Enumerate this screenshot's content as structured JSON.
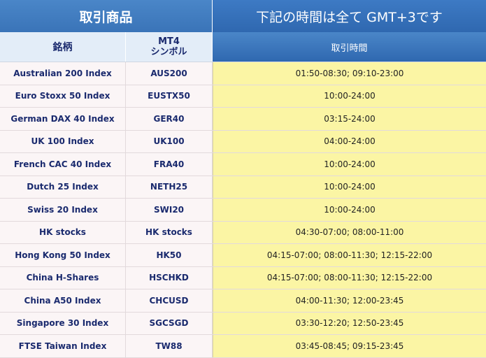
{
  "header": {
    "products_label": "取引商品",
    "note_label": "下記の時間は全て GMT+3です"
  },
  "subheader": {
    "name_label": "銘柄",
    "mt4_line1": "MT4",
    "mt4_line2": "シンボル",
    "hours_label": "取引時間"
  },
  "rows": [
    {
      "name": "Australian 200 Index",
      "symbol": "AUS200",
      "hours": "01:50-08:30; 09:10-23:00"
    },
    {
      "name": "Euro Stoxx 50 Index",
      "symbol": "EUSTX50",
      "hours": "10:00-24:00"
    },
    {
      "name": "German DAX 40 Index",
      "symbol": "GER40",
      "hours": "03:15-24:00"
    },
    {
      "name": "UK 100 Index",
      "symbol": "UK100",
      "hours": "04:00-24:00"
    },
    {
      "name": "French CAC 40 Index",
      "symbol": "FRA40",
      "hours": "10:00-24:00"
    },
    {
      "name": "Dutch 25 Index",
      "symbol": "NETH25",
      "hours": "10:00-24:00"
    },
    {
      "name": "Swiss 20 Index",
      "symbol": "SWI20",
      "hours": "10:00-24:00"
    },
    {
      "name": "HK stocks",
      "symbol": "HK stocks",
      "hours": "04:30-07:00; 08:00-11:00"
    },
    {
      "name": "Hong Kong 50 Index",
      "symbol": "HK50",
      "hours": "04:15-07:00; 08:00-11:30; 12:15-22:00"
    },
    {
      "name": "China H-Shares",
      "symbol": "HSCHKD",
      "hours": "04:15-07:00; 08:00-11:30; 12:15-22:00"
    },
    {
      "name": "China A50 Index",
      "symbol": "CHCUSD",
      "hours": "04:00-11:30; 12:00-23:45"
    },
    {
      "name": "Singapore 30 Index",
      "symbol": "SGCSGD",
      "hours": "03:30-12:20; 12:50-23:45"
    },
    {
      "name": "FTSE Taiwan Index",
      "symbol": "TW88",
      "hours": "03:45-08:45; 09:15-23:45"
    }
  ]
}
